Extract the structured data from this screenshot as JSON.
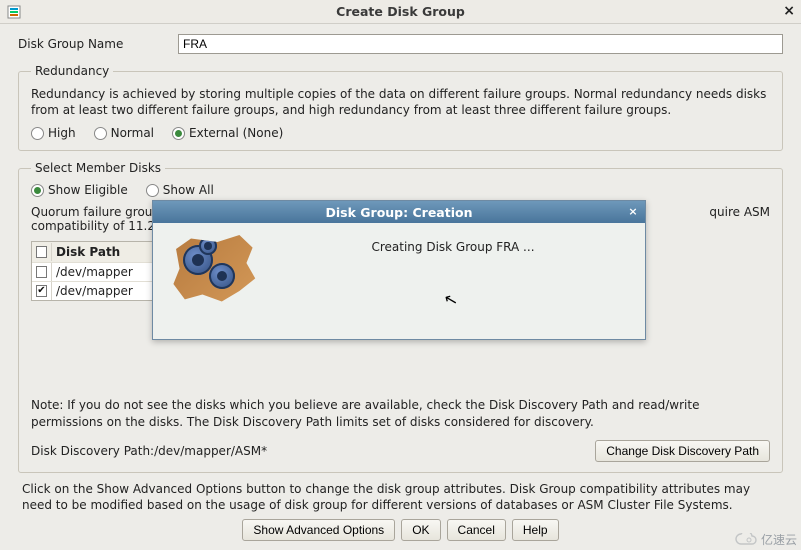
{
  "window": {
    "title": "Create Disk Group"
  },
  "form": {
    "disk_group_name_label": "Disk Group Name",
    "disk_group_name_value": "FRA"
  },
  "redundancy": {
    "legend": "Redundancy",
    "description": "Redundancy is achieved by storing multiple copies of the data on different failure groups. Normal redundancy needs disks from at least two different failure groups, and high redundancy from at least three different failure groups.",
    "options": {
      "high": "High",
      "normal": "Normal",
      "external": "External (None)"
    },
    "selected": "external"
  },
  "member": {
    "legend": "Select Member Disks",
    "filter": {
      "eligible": "Show Eligible",
      "all": "Show All",
      "selected": "eligible"
    },
    "quorum_note": "Quorum failure group",
    "compat_note": "compatibility of 11.2",
    "require_asm": "quire ASM",
    "table": {
      "col_diskpath": "Disk Path",
      "rows": [
        {
          "checked": false,
          "path": "/dev/mapper"
        },
        {
          "checked": true,
          "path": "/dev/mapper"
        }
      ]
    },
    "note": "Note: If you do not see the disks which you believe are available, check the Disk Discovery Path and read/write permissions on the disks. The Disk Discovery Path limits set of disks considered for discovery.",
    "discovery_label": "Disk Discovery Path:",
    "discovery_value": "/dev/mapper/ASM*",
    "change_btn": "Change Disk Discovery Path"
  },
  "bottom": {
    "note": "Click on the Show Advanced Options button to change the disk group attributes. Disk Group compatibility attributes may need to be modified based on the usage of disk group for different versions of databases or ASM Cluster File Systems.",
    "show_advanced": "Show Advanced Options",
    "ok": "OK",
    "cancel": "Cancel",
    "help": "Help"
  },
  "modal": {
    "title": "Disk Group: Creation",
    "message": "Creating Disk Group FRA ..."
  },
  "watermark": "亿速云"
}
